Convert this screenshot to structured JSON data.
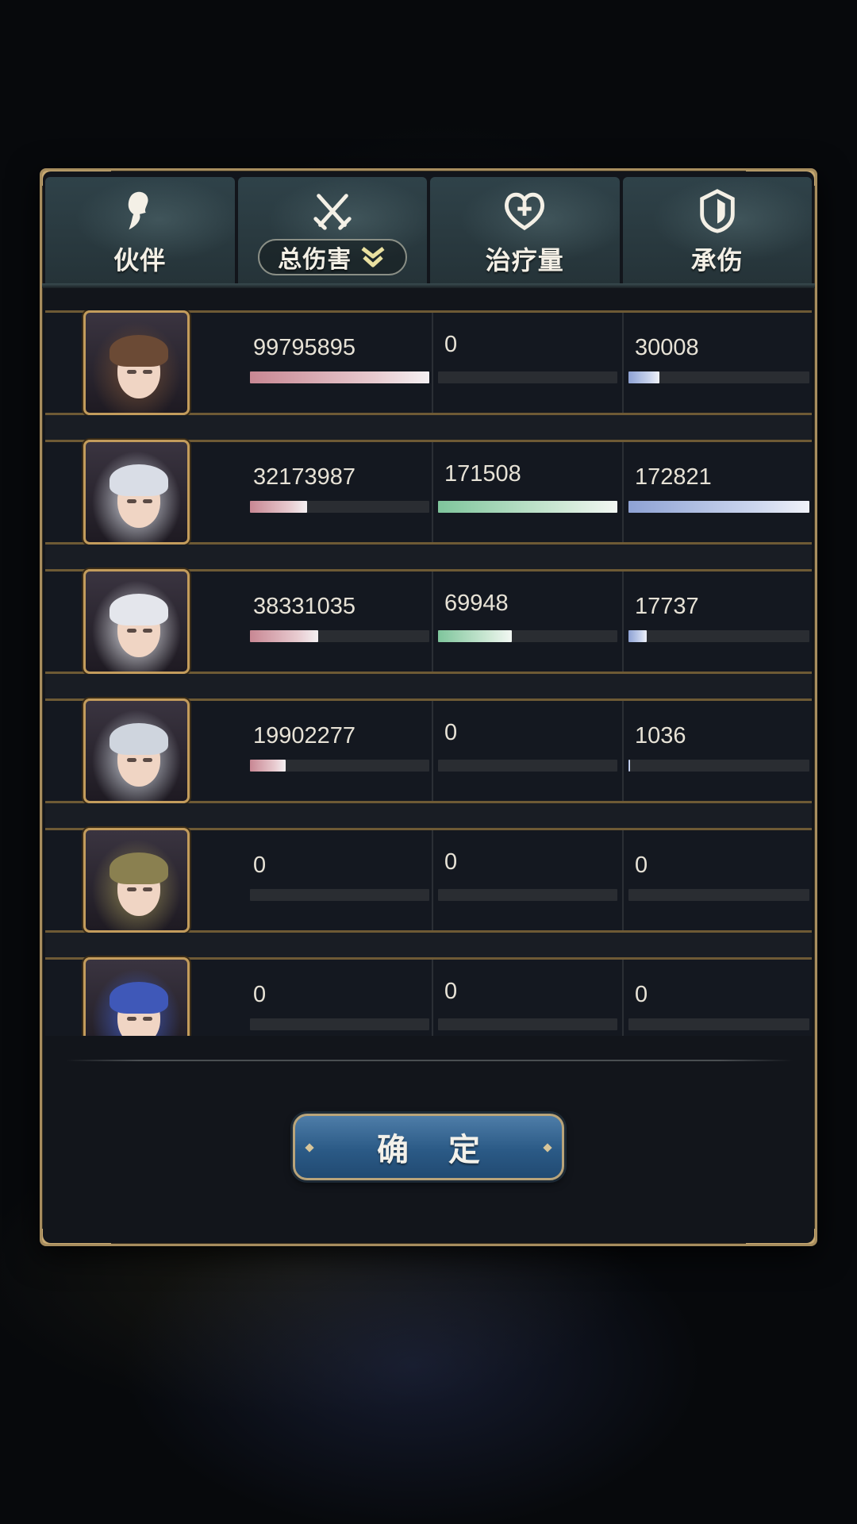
{
  "header": {
    "tabs": [
      {
        "label": "伙伴",
        "icon": "partner-silhouette-icon"
      },
      {
        "label": "总伤害",
        "icon": "crossed-swords-icon",
        "sortable": true
      },
      {
        "label": "治疗量",
        "icon": "heart-plus-icon"
      },
      {
        "label": "承伤",
        "icon": "shield-icon"
      }
    ]
  },
  "rows": [
    {
      "hair": "#6b4a35",
      "damage": "99795895",
      "damage_pct": 1.0,
      "heal": "0",
      "heal_pct": 0.0,
      "taken": "30008",
      "taken_pct": 0.17
    },
    {
      "hair": "#d9dde6",
      "damage": "32173987",
      "damage_pct": 0.32,
      "heal": "171508",
      "heal_pct": 1.0,
      "taken": "172821",
      "taken_pct": 1.0
    },
    {
      "hair": "#e4e6ec",
      "damage": "38331035",
      "damage_pct": 0.38,
      "heal": "69948",
      "heal_pct": 0.41,
      "taken": "17737",
      "taken_pct": 0.1
    },
    {
      "hair": "#cfd5de",
      "damage": "19902277",
      "damage_pct": 0.2,
      "heal": "0",
      "heal_pct": 0.0,
      "taken": "1036",
      "taken_pct": 0.01
    },
    {
      "hair": "#8a8050",
      "damage": "0",
      "damage_pct": 0.0,
      "heal": "0",
      "heal_pct": 0.0,
      "taken": "0",
      "taken_pct": 0.0
    },
    {
      "hair": "#3f58b8",
      "damage": "0",
      "damage_pct": 0.0,
      "heal": "0",
      "heal_pct": 0.0,
      "taken": "0",
      "taken_pct": 0.0
    }
  ],
  "confirm_label": "确 定",
  "colors": {
    "damage": "#c88793",
    "heal": "#7fc59c",
    "taken": "#8ea2d4",
    "frame": "#a78d5e"
  }
}
